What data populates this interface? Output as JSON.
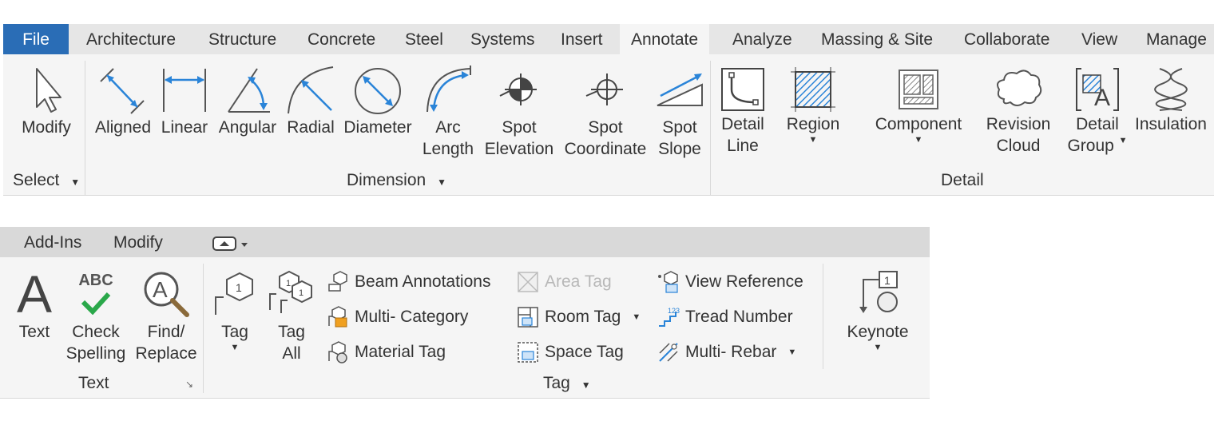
{
  "ribbon_top": {
    "tabs": [
      "File",
      "Architecture",
      "Structure",
      "Concrete",
      "Steel",
      "Systems",
      "Insert",
      "Annotate",
      "Analyze",
      "Massing & Site",
      "Collaborate",
      "View",
      "Manage"
    ],
    "active_tab": "Annotate",
    "select": {
      "modify": "Modify",
      "panel": "Select"
    },
    "dimension": {
      "aligned": "Aligned",
      "linear": "Linear",
      "angular": "Angular",
      "radial": "Radial",
      "diameter": "Diameter",
      "arc_1": "Arc",
      "arc_2": "Length",
      "spot_elev_1": "Spot",
      "spot_elev_2": "Elevation",
      "spot_coord_1": "Spot",
      "spot_coord_2": "Coordinate",
      "spot_slope_1": "Spot",
      "spot_slope_2": "Slope",
      "panel": "Dimension"
    },
    "detail": {
      "detail_line_1": "Detail",
      "detail_line_2": "Line",
      "region": "Region",
      "component": "Component",
      "revision_1": "Revision",
      "revision_2": "Cloud",
      "group_1": "Detail",
      "group_2": "Group",
      "insulation": "Insulation",
      "panel": "Detail"
    }
  },
  "ribbon_bottom": {
    "tabs": [
      "Add-Ins",
      "Modify"
    ],
    "text_panel": {
      "text": "Text",
      "check_1": "Check",
      "check_2": "Spelling",
      "find_1": "Find/",
      "find_2": "Replace",
      "abc": "ABC",
      "panel": "Text"
    },
    "tag_panel": {
      "tag": "Tag",
      "tag_all_1": "Tag",
      "tag_all_2": "All",
      "beam": "Beam  Annotations",
      "multi_cat": "Multi- Category",
      "material": "Material  Tag",
      "area": "Area  Tag",
      "room": "Room  Tag",
      "space": "Space  Tag",
      "view_ref": "View  Reference",
      "tread": "Tread  Number",
      "rebar": "Multi- Rebar",
      "panel": "Tag"
    },
    "keynote": {
      "label": "Keynote"
    }
  },
  "colors": {
    "file_tab": "#2a6db6",
    "accent_blue": "#2a84d8",
    "check_green": "#2aa84a"
  }
}
